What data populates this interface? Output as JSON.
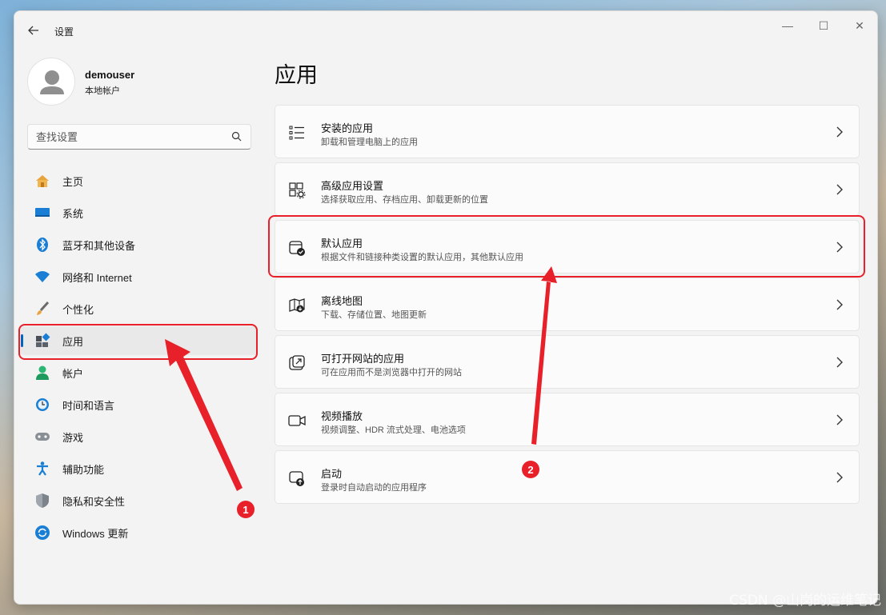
{
  "window": {
    "title": "设置"
  },
  "window_controls": {
    "minimize": "—",
    "maximize": "☐",
    "close": "✕"
  },
  "user": {
    "name": "demouser",
    "account_type": "本地帐户"
  },
  "search": {
    "placeholder": "查找设置"
  },
  "sidebar": {
    "items": [
      {
        "label": "主页",
        "icon": "home-icon"
      },
      {
        "label": "系统",
        "icon": "monitor-icon"
      },
      {
        "label": "蓝牙和其他设备",
        "icon": "bluetooth-icon"
      },
      {
        "label": "网络和 Internet",
        "icon": "wifi-icon"
      },
      {
        "label": "个性化",
        "icon": "brush-icon"
      },
      {
        "label": "应用",
        "icon": "apps-icon",
        "selected": true
      },
      {
        "label": "帐户",
        "icon": "account-icon"
      },
      {
        "label": "时间和语言",
        "icon": "clock-globe-icon"
      },
      {
        "label": "游戏",
        "icon": "gamepad-icon"
      },
      {
        "label": "辅助功能",
        "icon": "accessibility-icon"
      },
      {
        "label": "隐私和安全性",
        "icon": "shield-icon"
      },
      {
        "label": "Windows 更新",
        "icon": "update-icon"
      }
    ]
  },
  "main": {
    "title": "应用",
    "cards": [
      {
        "title": "安装的应用",
        "desc": "卸载和管理电脑上的应用",
        "icon": "list-icon"
      },
      {
        "title": "高级应用设置",
        "desc": "选择获取应用、存档应用、卸载更新的位置",
        "icon": "app-settings-icon"
      },
      {
        "title": "默认应用",
        "desc": "根据文件和链接种类设置的默认应用，其他默认应用",
        "icon": "default-apps-icon"
      },
      {
        "title": "离线地图",
        "desc": "下载、存储位置、地图更新",
        "icon": "offline-map-icon"
      },
      {
        "title": "可打开网站的应用",
        "desc": "可在应用而不是浏览器中打开的网站",
        "icon": "open-link-icon"
      },
      {
        "title": "视频播放",
        "desc": "视频调整、HDR 流式处理、电池选项",
        "icon": "video-icon"
      },
      {
        "title": "启动",
        "desc": "登录时自动启动的应用程序",
        "icon": "startup-icon"
      }
    ]
  },
  "annotations": {
    "badge1": "1",
    "badge2": "2",
    "highlight_color": "#e8202a"
  },
  "watermark": "CSDN @山岗的运维笔记",
  "colors": {
    "accent": "#0067c0",
    "window_bg": "#f3f3f3",
    "card_bg": "#fbfbfb"
  }
}
